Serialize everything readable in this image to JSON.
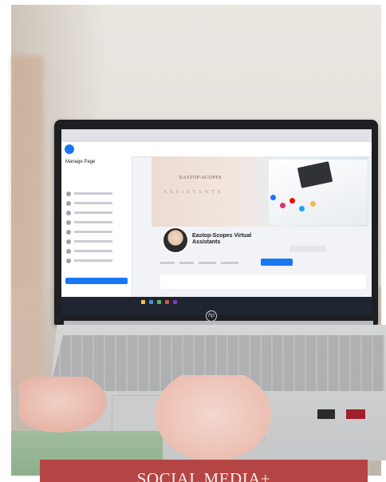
{
  "banner": {
    "text": "SOCIAL MEDIA+"
  },
  "facebook": {
    "sidebar_title": "Manage Page",
    "cover_title": "EASTOP-SCOPES",
    "cover_subtitle": "ASSISTANTS",
    "page_name": "Eastop-Scopes Virtual Assistants"
  },
  "laptop": {
    "brand_mark": "hp"
  },
  "colors": {
    "banner": "#b54545",
    "facebook_blue": "#1877f2",
    "sleeve": "#9fbd9b"
  }
}
